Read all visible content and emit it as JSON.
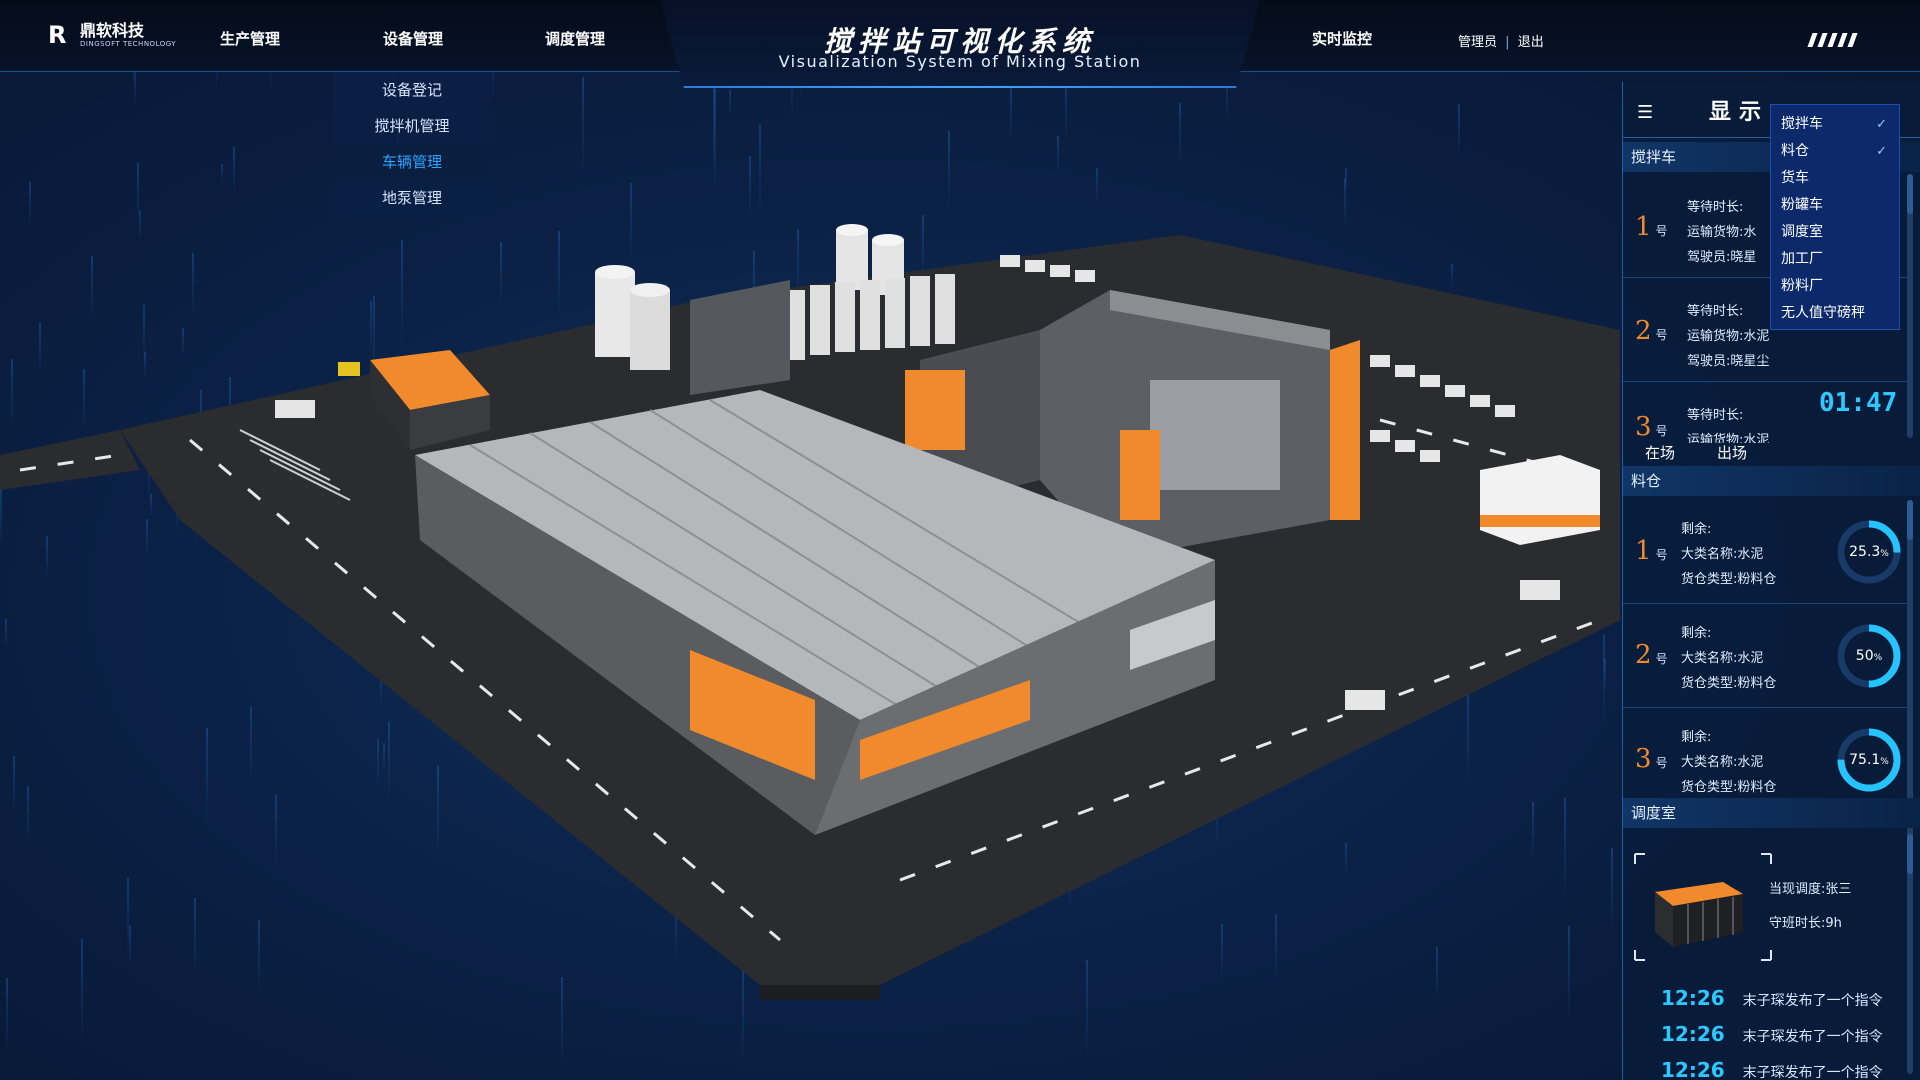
{
  "header": {
    "logo_cn": "鼎软科技",
    "logo_en": "DINGSOFT TECHNOLOGY",
    "nav": [
      "生产管理",
      "设备管理",
      "调度管理"
    ],
    "title_cn": "搅拌站可视化系统",
    "title_en": "Visualization System of Mixing Station",
    "monitor": "实时监控",
    "admin": "管理员",
    "separator": "|",
    "logout": "退出"
  },
  "submenu": {
    "items": [
      "设备登记",
      "搅拌机管理",
      "车辆管理",
      "地泵管理"
    ],
    "active": "车辆管理"
  },
  "panel": {
    "title": "显示",
    "section_mixer": "搅拌车",
    "mixers": [
      {
        "num": "1",
        "unit": "号",
        "wait_label": "等待时长:",
        "cargo": "运输货物:水",
        "driver": "驾驶员:晓星"
      },
      {
        "num": "2",
        "unit": "号",
        "wait_label": "等待时长:",
        "cargo": "运输货物:水泥",
        "driver": "驾驶员:晓星尘"
      },
      {
        "num": "3",
        "unit": "号",
        "wait_label": "等待时长:",
        "cargo": "运输货物:水泥"
      }
    ],
    "timer": "01:47",
    "tabs": [
      "在场",
      "出场"
    ],
    "section_silo": "料仓",
    "silos": [
      {
        "num": "1",
        "unit": "号",
        "remain": "剩余:",
        "cat": "大类名称:水泥",
        "type": "货仓类型:粉料仓",
        "pct": 25.3,
        "pct_label": "25.3",
        "sign": "%"
      },
      {
        "num": "2",
        "unit": "号",
        "remain": "剩余:",
        "cat": "大类名称:水泥",
        "type": "货仓类型:粉料仓",
        "pct": 50,
        "pct_label": "50",
        "sign": "%"
      },
      {
        "num": "3",
        "unit": "号",
        "remain": "剩余:",
        "cat": "大类名称:水泥",
        "type": "货仓类型:粉料仓",
        "pct": 75.1,
        "pct_label": "75.1",
        "sign": "%"
      }
    ],
    "section_dispatch": "调度室",
    "dispatcher": "当现调度:张三",
    "shift": "守班时长:9h",
    "logs": [
      {
        "time": "12:26",
        "text": "末子琛发布了一个指令"
      },
      {
        "time": "12:26",
        "text": "末子琛发布了一个指令"
      },
      {
        "time": "12:26",
        "text": "末子琛发布了一个指令"
      }
    ]
  },
  "layer_menu": {
    "items": [
      {
        "label": "搅拌车",
        "checked": true,
        "check": "✓"
      },
      {
        "label": "料仓",
        "checked": true,
        "check": "✓"
      },
      {
        "label": "货车",
        "checked": false,
        "check": ""
      },
      {
        "label": "粉罐车",
        "checked": false,
        "check": ""
      },
      {
        "label": "调度室",
        "checked": false,
        "check": ""
      },
      {
        "label": "加工厂",
        "checked": false,
        "check": ""
      },
      {
        "label": "粉料厂",
        "checked": false,
        "check": ""
      },
      {
        "label": "无人值守磅秤",
        "checked": false,
        "check": ""
      }
    ]
  },
  "colors": {
    "accent": "#2ec7ff",
    "orange": "#f08a2c",
    "panel_bg": "#08203f",
    "menu_bg": "#0c2a6b"
  }
}
